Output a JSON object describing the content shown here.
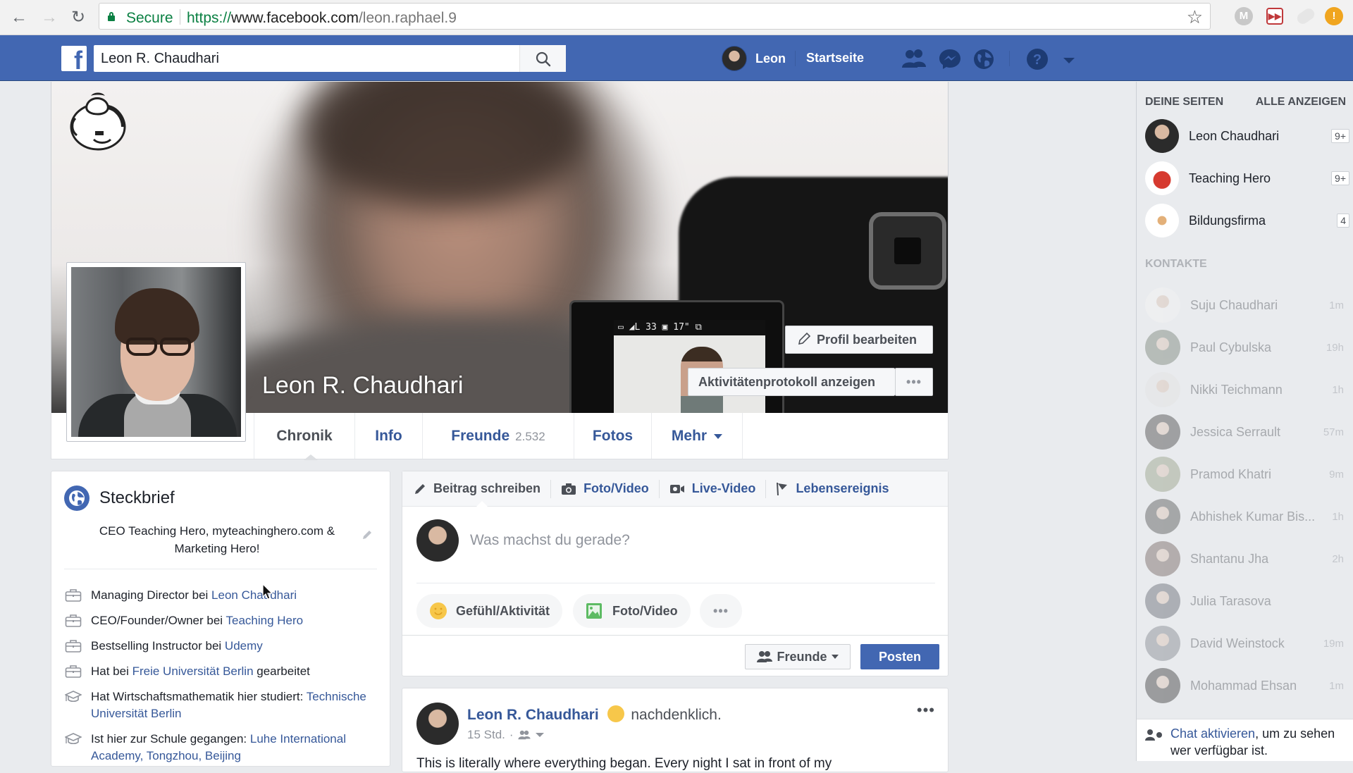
{
  "browser": {
    "back_icon": "arrow-left-icon",
    "forward_icon": "arrow-right-icon",
    "reload_icon": "reload-icon",
    "secure_label": "Secure",
    "url_scheme": "https://",
    "url_host": "www.facebook.com",
    "url_path": "/leon.raphael.9",
    "extensions": [
      "gmail-extension-icon",
      "video-speed-extension-icon",
      "ghost-extension-icon",
      "alert-extension-icon"
    ]
  },
  "topbar": {
    "search_value": "Leon R. Chaudhari",
    "user_name": "Leon",
    "home_label": "Startseite",
    "icons": [
      "friend-requests-icon",
      "messenger-icon",
      "notifications-globe-icon",
      "help-icon",
      "account-menu-caret-icon"
    ]
  },
  "profile": {
    "name": "Leon R. Chaudhari",
    "edit_profile_label": "Profil bearbeiten",
    "activity_log_label": "Aktivitätenprotokoll anzeigen",
    "more_label": "•••",
    "camera_hud": "▭ ◢L 33  ▣ 17\"   ⧉",
    "tabs": [
      {
        "label": "Chronik",
        "active": true
      },
      {
        "label": "Info"
      },
      {
        "label": "Freunde",
        "count": "2.532"
      },
      {
        "label": "Fotos"
      },
      {
        "label": "Mehr"
      }
    ]
  },
  "intro": {
    "title": "Steckbrief",
    "bio": "CEO Teaching Hero, myteachinghero.com & Marketing Hero!",
    "items": [
      {
        "type": "work",
        "prefix": "Managing Director bei ",
        "link": "Leon Chaudhari",
        "suffix": ""
      },
      {
        "type": "work",
        "prefix": "CEO/Founder/Owner bei ",
        "link": "Teaching Hero",
        "suffix": ""
      },
      {
        "type": "work",
        "prefix": "Bestselling Instructor bei ",
        "link": "Udemy",
        "suffix": ""
      },
      {
        "type": "work",
        "prefix": "Hat bei ",
        "link": "Freie Universität Berlin",
        "suffix": " gearbeitet"
      },
      {
        "type": "education",
        "prefix": "Hat Wirtschaftsmathematik hier studiert: ",
        "link": "Technische Universität Berlin",
        "suffix": ""
      },
      {
        "type": "education",
        "prefix": "Ist hier zur Schule gegangen: ",
        "link": "Luhe International Academy, Tongzhou, Beijing",
        "suffix": ""
      }
    ]
  },
  "composer": {
    "tabs": [
      "Beitrag schreiben",
      "Foto/Video",
      "Live-Video",
      "Lebensereignis"
    ],
    "placeholder": "Was machst du gerade?",
    "feeling_label": "Gefühl/Aktivität",
    "photo_label": "Foto/Video",
    "more_label": "•••",
    "audience_label": "Freunde",
    "post_label": "Posten"
  },
  "post": {
    "author": "Leon R. Chaudhari",
    "feeling": "nachdenklich.",
    "time": "15 Std.",
    "separator": "·",
    "more_label": "•••",
    "text": "This is literally where everything began. Every night I sat in front of my"
  },
  "sidebar": {
    "pages_header": "DEINE SEITEN",
    "see_all_label": "ALLE ANZEIGEN",
    "pages": [
      {
        "name": "Leon Chaudhari",
        "badge": "9+"
      },
      {
        "name": "Teaching Hero",
        "badge": "9+"
      },
      {
        "name": "Bildungsfirma",
        "badge": "4"
      }
    ],
    "contacts_header": "KONTAKTE",
    "contacts": [
      {
        "name": "Suju Chaudhari",
        "time": "1m"
      },
      {
        "name": "Paul Cybulska",
        "time": "19h"
      },
      {
        "name": "Nikki Teichmann",
        "time": "1h"
      },
      {
        "name": "Jessica Serrault",
        "time": "57m"
      },
      {
        "name": "Pramod Khatri",
        "time": "9m"
      },
      {
        "name": "Abhishek Kumar Bis...",
        "time": "1h"
      },
      {
        "name": "Shantanu Jha",
        "time": "2h"
      },
      {
        "name": "Julia Tarasova",
        "time": ""
      },
      {
        "name": "David Weinstock",
        "time": "19m"
      },
      {
        "name": "Mohammad Ehsan",
        "time": "1m"
      }
    ],
    "chat_link": "Chat aktivieren",
    "chat_text": ", um zu sehen wer verfügbar ist."
  },
  "colors": {
    "fb_blue": "#4267b2",
    "link": "#365899",
    "secure_green": "#0b8043"
  }
}
